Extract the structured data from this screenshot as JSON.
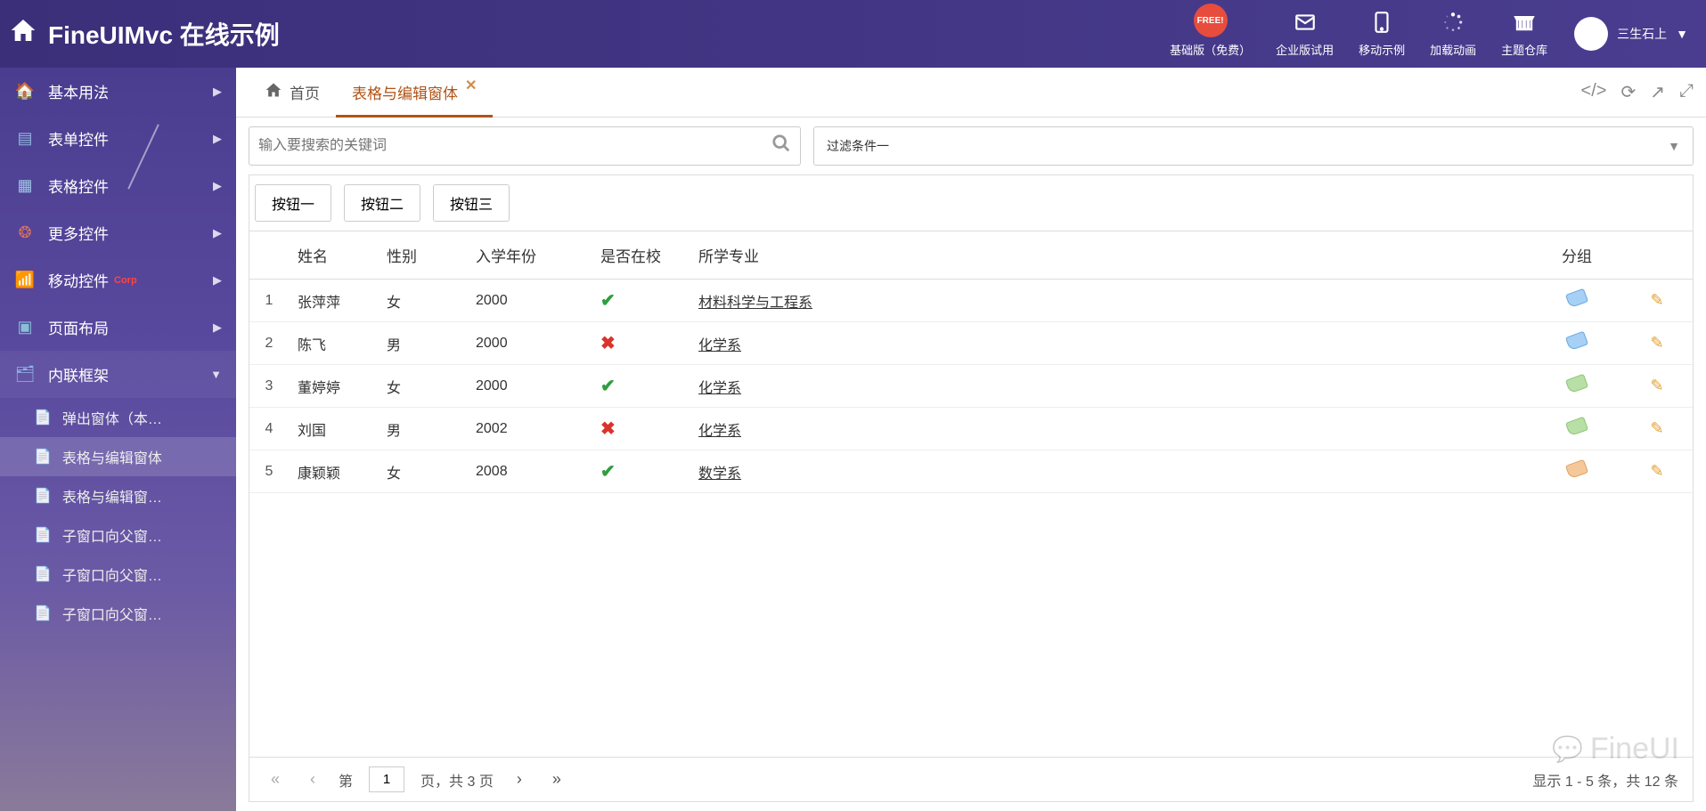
{
  "header": {
    "title": "FineUIMvc 在线示例",
    "nav": [
      {
        "label": "基础版（免费）",
        "icon": "download",
        "free_badge": "FREE!"
      },
      {
        "label": "企业版试用",
        "icon": "envelope"
      },
      {
        "label": "移动示例",
        "icon": "mobile"
      },
      {
        "label": "加载动画",
        "icon": "spinner"
      },
      {
        "label": "主题仓库",
        "icon": "archive"
      }
    ],
    "user_name": "三生石上"
  },
  "sidebar": {
    "items": [
      {
        "label": "基本用法",
        "icon": "home",
        "color": "ic-home2"
      },
      {
        "label": "表单控件",
        "icon": "form",
        "color": "ic-form"
      },
      {
        "label": "表格控件",
        "icon": "grid",
        "color": "ic-grid"
      },
      {
        "label": "更多控件",
        "icon": "more",
        "color": "ic-more"
      },
      {
        "label": "移动控件",
        "icon": "mobile",
        "color": "ic-mobile",
        "badge": "Corp"
      },
      {
        "label": "页面布局",
        "icon": "layout",
        "color": "ic-layout"
      },
      {
        "label": "内联框架",
        "icon": "frame",
        "color": "ic-frame",
        "expanded": true
      }
    ],
    "subitems": [
      {
        "label": "弹出窗体（本…"
      },
      {
        "label": "表格与编辑窗体",
        "active": true
      },
      {
        "label": "表格与编辑窗…"
      },
      {
        "label": "子窗口向父窗…"
      },
      {
        "label": "子窗口向父窗…"
      },
      {
        "label": "子窗口向父窗…"
      }
    ]
  },
  "tabs": {
    "items": [
      {
        "label": "首页",
        "icon": "home"
      },
      {
        "label": "表格与编辑窗体",
        "active": true,
        "closable": true
      }
    ]
  },
  "search": {
    "placeholder": "输入要搜索的关键词"
  },
  "filter": {
    "selected": "过滤条件一"
  },
  "buttons": [
    "按钮一",
    "按钮二",
    "按钮三"
  ],
  "table": {
    "columns": {
      "name": "姓名",
      "gender": "性别",
      "year": "入学年份",
      "atschool": "是否在校",
      "major": "所学专业",
      "group": "分组"
    },
    "rows": [
      {
        "idx": "1",
        "name": "张萍萍",
        "gender": "女",
        "year": "2000",
        "atschool": true,
        "major": "材料科学与工程系",
        "tag": "blue"
      },
      {
        "idx": "2",
        "name": "陈飞",
        "gender": "男",
        "year": "2000",
        "atschool": false,
        "major": "化学系",
        "tag": "blue"
      },
      {
        "idx": "3",
        "name": "董婷婷",
        "gender": "女",
        "year": "2000",
        "atschool": true,
        "major": "化学系",
        "tag": "green"
      },
      {
        "idx": "4",
        "name": "刘国",
        "gender": "男",
        "year": "2002",
        "atschool": false,
        "major": "化学系",
        "tag": "green"
      },
      {
        "idx": "5",
        "name": "康颖颖",
        "gender": "女",
        "year": "2008",
        "atschool": true,
        "major": "数学系",
        "tag": "orange"
      }
    ]
  },
  "pager": {
    "page_label_prefix": "第",
    "current_page": "1",
    "page_label_suffix": "页，共 3 页",
    "info": "显示 1 - 5 条，共 12 条"
  },
  "watermark": "FineUI"
}
